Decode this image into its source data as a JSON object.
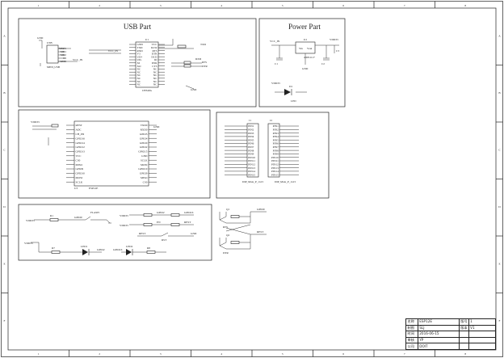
{
  "frame": {
    "col_labels": [
      "1",
      "2",
      "3",
      "4",
      "5",
      "6",
      "7",
      "8"
    ],
    "row_labels": [
      "A",
      "B",
      "C",
      "D",
      "E",
      "F"
    ]
  },
  "usb_part": {
    "title": "USB Part",
    "usb_label": "USB",
    "usb_pins": [
      "VBUS",
      "MD1",
      "MD2",
      "ID",
      "GND"
    ],
    "usb_refs": [
      "GND",
      "VCC_IN",
      "MINI_USB"
    ],
    "ic_ref": "U1",
    "ic_name": "CH340G",
    "ic_left_pins": [
      "GND",
      "TXD",
      "RXD",
      "V3",
      "UD+",
      "UD-",
      "XI",
      "XO",
      "NC",
      "NC",
      "NC",
      "NC",
      "NC",
      "NC"
    ],
    "ic_right_pins": [
      "VCC",
      "R232",
      "RTS",
      "DTR",
      "DCD",
      "RI",
      "DSR",
      "CTS",
      "NC",
      "NC",
      "NC",
      "NC",
      "NC",
      "NC"
    ],
    "nets": [
      "TXD",
      "RXD",
      "RTS",
      "DTR",
      "GND",
      "VCC_IN"
    ]
  },
  "power_part": {
    "title": "Power Part",
    "reg_ref": "U2",
    "reg_name": "AMS1117",
    "reg_pins": [
      "Vin",
      "GND",
      "Vout"
    ],
    "caps": [
      "C1",
      "C2",
      "C3"
    ],
    "nets": [
      "VCC_IN",
      "VDD33",
      "GND"
    ],
    "diode": "D1",
    "led_label": "LED"
  },
  "esp_part": {
    "ic_ref": "U3",
    "ic_name": "ESP12E",
    "left_pins": [
      "REST",
      "ADC",
      "CH_PD",
      "GPIO16",
      "GPIO14",
      "GPIO12",
      "GPIO13",
      "VCC",
      "CS0",
      "MISO",
      "GPIO9",
      "GPIO10",
      "MOSI",
      "SCLK"
    ],
    "right_pins": [
      "TXD0",
      "RXD0",
      "GPIO5",
      "GPIO4",
      "GPIO0",
      "GPIO2",
      "GPIO15",
      "GND",
      "SCLK",
      "MOSI",
      "GPIO10",
      "GPIO9",
      "MISO",
      "CS0"
    ],
    "nets": [
      "VDD33",
      "GND"
    ]
  },
  "header_part": {
    "left_ref": "J1",
    "left_name": "DIP_Male_P_1x15",
    "right_ref": "J2",
    "right_name": "DIP_Male_P_1x15",
    "pins": [
      "PIN1",
      "PIN2",
      "PIN3",
      "PIN4",
      "PIN5",
      "PIN6",
      "PIN7",
      "PIN8",
      "PIN9",
      "PIN10",
      "PIN11",
      "PIN12",
      "PIN13",
      "PIN14",
      "PIN15"
    ]
  },
  "io_part": {
    "nets": [
      "VDD33",
      "GPIO0",
      "GPIO2",
      "GPIO16",
      "REST",
      "EN",
      "GND"
    ],
    "parts": [
      "R1",
      "R2",
      "R3",
      "R4",
      "R5",
      "R6",
      "R7",
      "R8"
    ],
    "switches": [
      "FLASH",
      "RST"
    ],
    "leds": [
      "LED1",
      "LED2"
    ]
  },
  "transistor_part": {
    "parts": [
      "Q1",
      "Q2"
    ],
    "nets": [
      "RTS",
      "DTR",
      "GPIO0",
      "REST"
    ]
  },
  "title_block": {
    "rows": [
      {
        "k": "名称",
        "v": "ESP12E",
        "k2": "版号",
        "v2": "1"
      },
      {
        "k": "制图",
        "v": "SLJ",
        "k2": "版本",
        "v2": "V1"
      },
      {
        "k": "时间",
        "v": "2016-06-15",
        "k2": "",
        "v2": ""
      },
      {
        "k": "审核",
        "v": "YP",
        "k2": "",
        "v2": ""
      },
      {
        "k": "公司",
        "v": "DOIT",
        "k2": "",
        "v2": ""
      }
    ]
  }
}
